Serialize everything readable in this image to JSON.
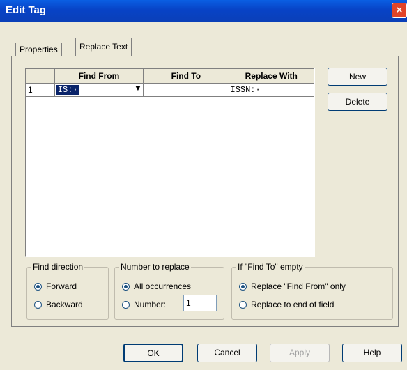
{
  "window": {
    "title": "Edit Tag",
    "close_glyph": "×"
  },
  "tabs": [
    {
      "label": "Properties"
    },
    {
      "label": "Replace Text"
    }
  ],
  "table": {
    "headers": [
      "",
      "Find From",
      "Find To",
      "Replace With"
    ],
    "rows": [
      {
        "num": "1",
        "find_from": "IS:·",
        "find_to": "",
        "replace_with": "ISSN:·"
      }
    ],
    "dropdown_glyph": "▼"
  },
  "side_buttons": {
    "new": "New",
    "delete": "Delete"
  },
  "find_direction": {
    "label": "Find direction",
    "forward": "Forward",
    "backward": "Backward",
    "selected": "forward"
  },
  "number_to_replace": {
    "label": "Number to replace",
    "all": "All occurrences",
    "number": "Number:",
    "number_value": "1",
    "selected": "all"
  },
  "if_empty": {
    "label": "If \"Find To\" empty",
    "replace_only": "Replace \"Find From\" only",
    "replace_to_end": "Replace to end of field",
    "selected": "replace_only"
  },
  "bottom_buttons": {
    "ok": "OK",
    "cancel": "Cancel",
    "apply": "Apply",
    "help": "Help"
  }
}
